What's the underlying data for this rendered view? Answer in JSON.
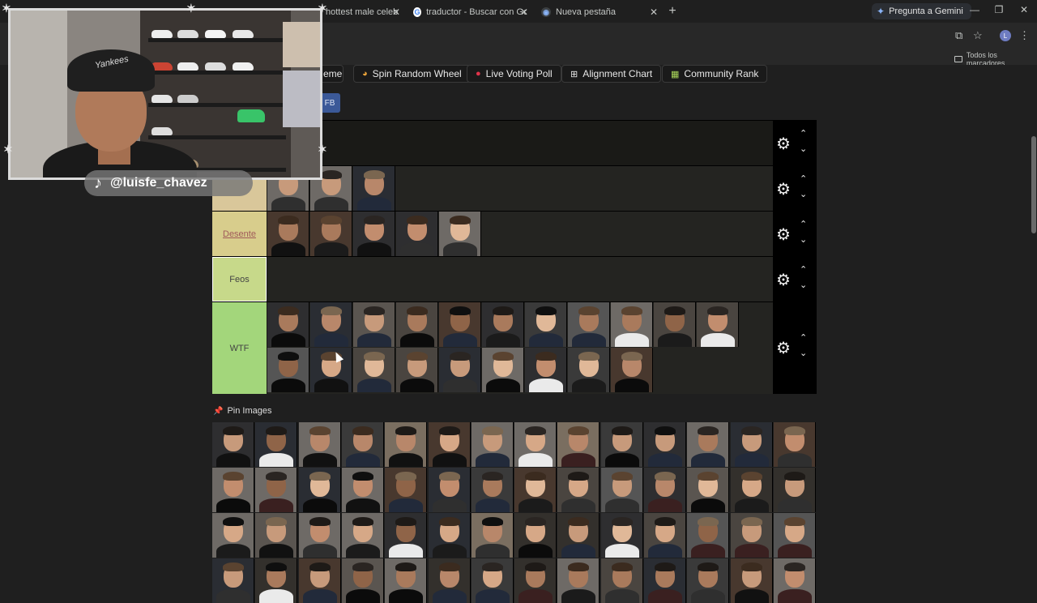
{
  "browser": {
    "tabs": [
      {
        "title": "hottest male celebriti",
        "icon": "tierlist-favicon",
        "color": "#f0a020"
      },
      {
        "title": "traductor - Buscar con Google",
        "icon": "google-icon",
        "color": "#4285f4"
      },
      {
        "title": "Nueva pestaña",
        "icon": "chrome-icon",
        "color": "#8ab4f8"
      }
    ],
    "gemini_label": "Pregunta a Gemini",
    "bookmarks_folder": "Todos los marcadores",
    "profile_initial": "L"
  },
  "toolbar": {
    "buttons": [
      {
        "label": "eme",
        "icon": ""
      },
      {
        "label": "Spin Random Wheel",
        "icon": "wheel-icon"
      },
      {
        "label": "Live Voting Poll",
        "icon": "poll-dot-icon"
      },
      {
        "label": "Alignment Chart",
        "icon": "grid-icon"
      },
      {
        "label": "Community Rank",
        "icon": "rank-icon"
      }
    ],
    "fb_label": "FB"
  },
  "tiers": [
    {
      "label": "",
      "color": "#1a1a17",
      "count": 0
    },
    {
      "label": "",
      "color": "#d9c79a",
      "count": 3
    },
    {
      "label": "Desente",
      "color": "#d8cd8c",
      "count": 5
    },
    {
      "label": "Feos",
      "color": "#c7d98a",
      "count": 0
    },
    {
      "label": "WTF",
      "color": "#a3d67b",
      "count": 20
    }
  ],
  "pool": {
    "label": "Pin Images",
    "rows": 4,
    "cols": 14
  },
  "overlay": {
    "tiktok_handle": "@luisfe_chavez",
    "cap_text": "Yankees"
  }
}
